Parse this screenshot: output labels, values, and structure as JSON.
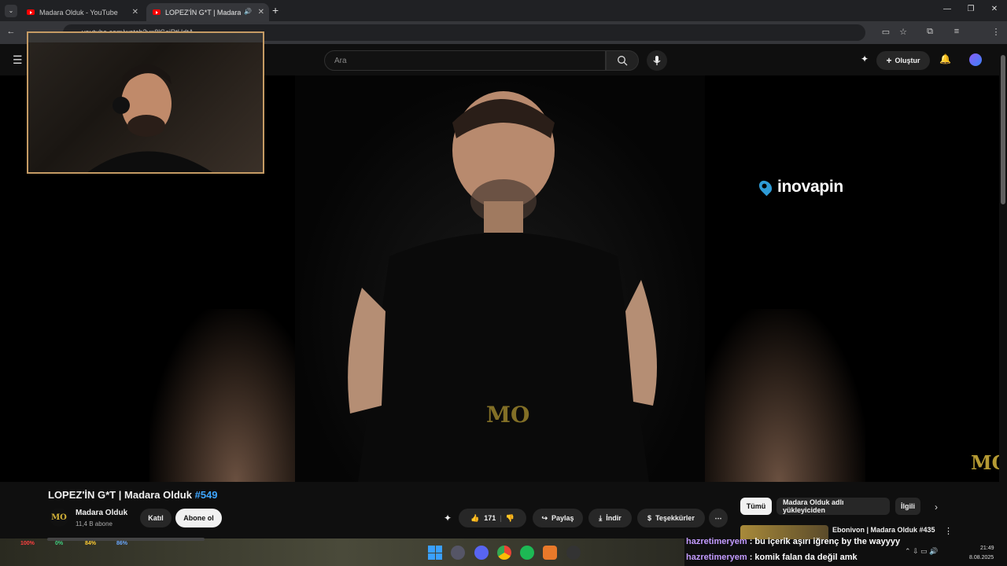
{
  "browser": {
    "tabs": [
      {
        "title": "Madara Olduk - YouTube",
        "active": false
      },
      {
        "title": "LOPEZ'İN G*T | Madara Old",
        "active": true
      }
    ],
    "url": "youtube.com/watch?v=8lGciRtUdtA"
  },
  "youtube": {
    "search_placeholder": "Ara",
    "create_label": "Oluştur"
  },
  "video": {
    "sponsor_logo": "inovapin",
    "watermark": "MO"
  },
  "info": {
    "title": "LOPEZ'İN G*T | Madara Olduk",
    "title_tag": "#549",
    "channel": "Madara Olduk",
    "subscribers": "11,4 B abone",
    "join_label": "Katıl",
    "subscribe_label": "Abone ol",
    "like_count": "171",
    "share_label": "Paylaş",
    "download_label": "İndir",
    "thanks_label": "Teşekkürler"
  },
  "recommend": {
    "chips": [
      "Tümü",
      "Madara Olduk adlı yükleyiciden",
      "İlgili"
    ],
    "first_video_title": "Ebonivon | Madara Olduk #435"
  },
  "overlay": {
    "stats": [
      {
        "value": "100%",
        "color": "#ff4040"
      },
      {
        "value": "0%",
        "color": "#40d080"
      },
      {
        "value": "84%",
        "color": "#ffcc33"
      },
      {
        "value": "86%",
        "color": "#6aa8ff"
      }
    ],
    "chat": [
      {
        "user": "hazretimeryem",
        "message": " : bu içerik aşırı iğrenç by the wayyyy"
      },
      {
        "user": "hazretimeryem",
        "message": " : komik falan da değil amk"
      }
    ]
  },
  "clock": {
    "time": "21:49",
    "date": "8.08.2025"
  }
}
